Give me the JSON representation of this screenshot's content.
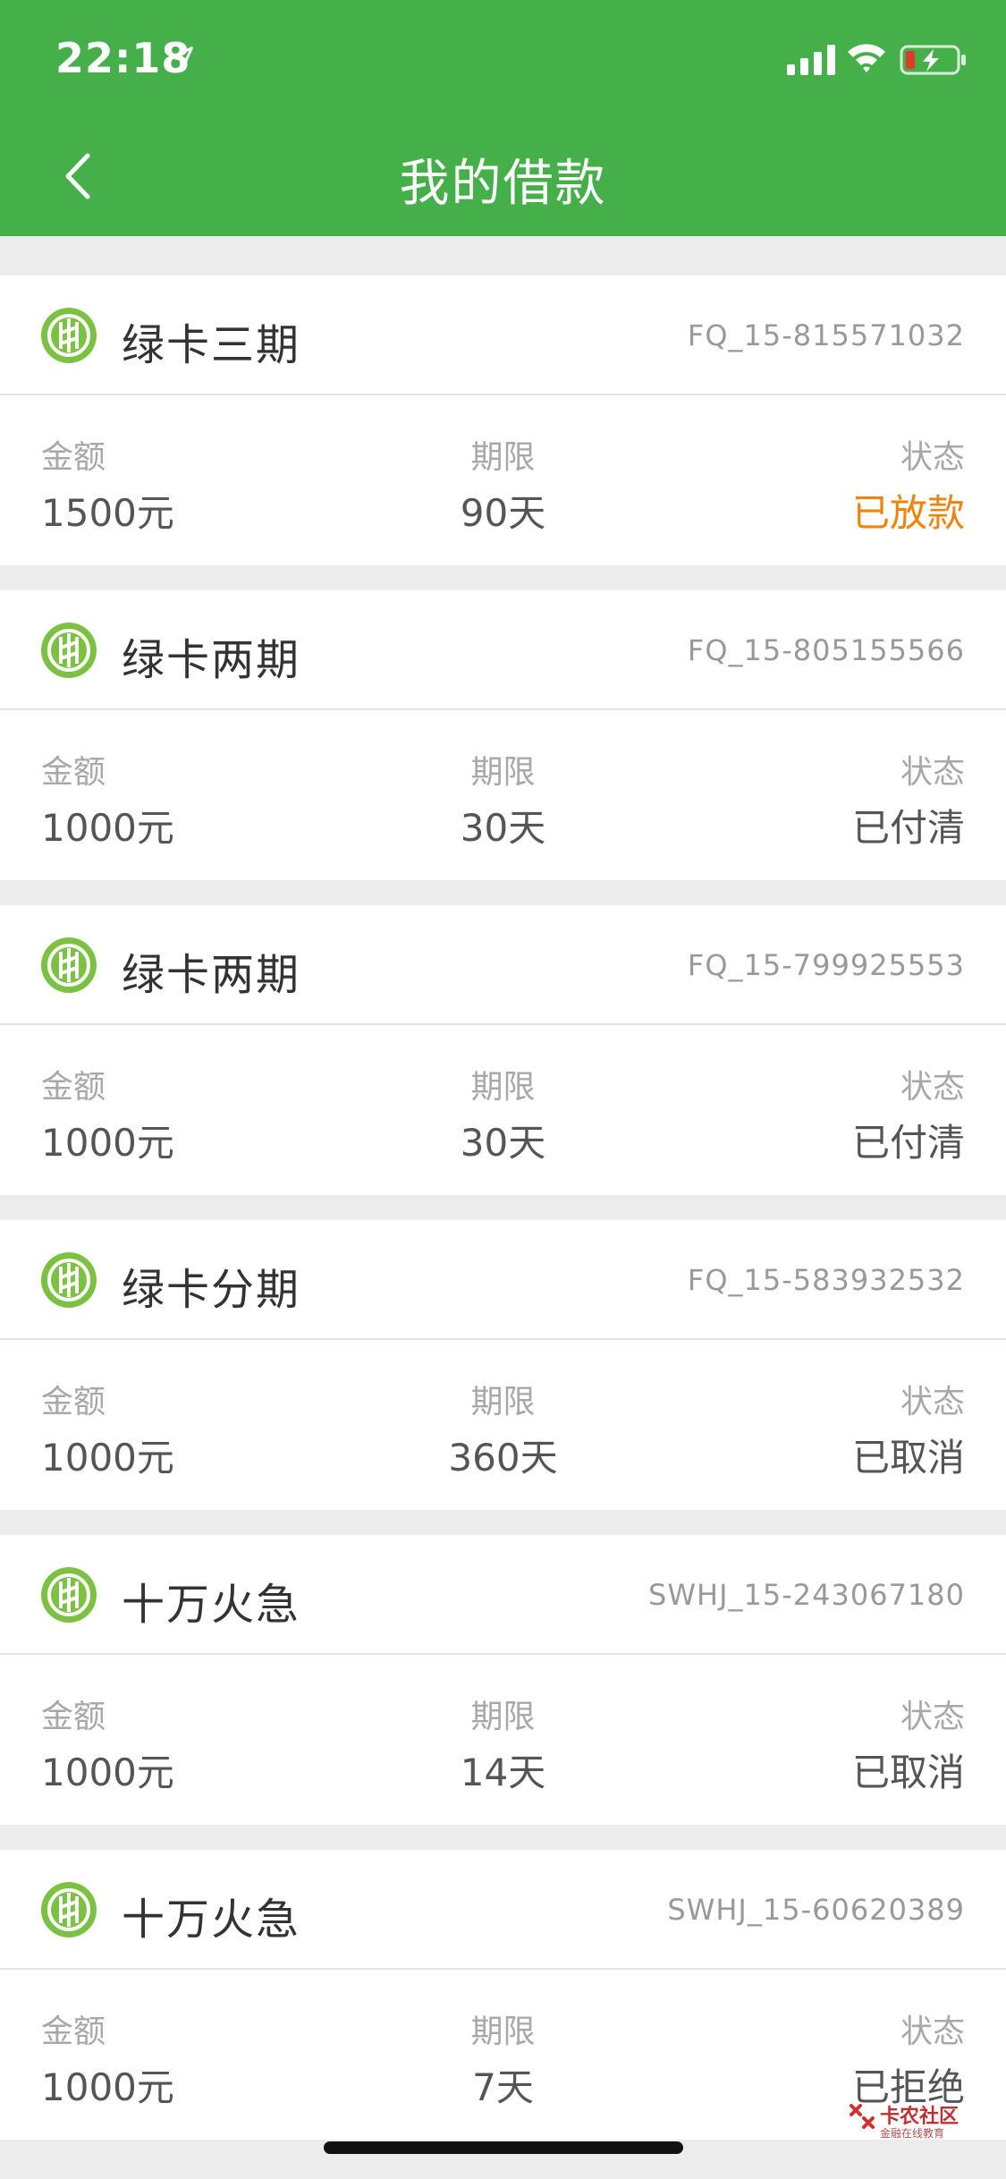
{
  "status_bar": {
    "time": "22:18"
  },
  "nav": {
    "title": "我的借款"
  },
  "labels": {
    "amount": "金额",
    "term": "期限",
    "status": "状态"
  },
  "colors": {
    "brand_green": "#45b04a",
    "status_orange": "#f0830c"
  },
  "loans": [
    {
      "product": "绿卡三期",
      "order_no": "FQ_15-815571032",
      "amount": "1500元",
      "term": "90天",
      "status": "已放款",
      "highlight": true
    },
    {
      "product": "绿卡两期",
      "order_no": "FQ_15-805155566",
      "amount": "1000元",
      "term": "30天",
      "status": "已付清",
      "highlight": false
    },
    {
      "product": "绿卡两期",
      "order_no": "FQ_15-799925553",
      "amount": "1000元",
      "term": "30天",
      "status": "已付清",
      "highlight": false
    },
    {
      "product": "绿卡分期",
      "order_no": "FQ_15-583932532",
      "amount": "1000元",
      "term": "360天",
      "status": "已取消",
      "highlight": false
    },
    {
      "product": "十万火急",
      "order_no": "SWHJ_15-243067180",
      "amount": "1000元",
      "term": "14天",
      "status": "已取消",
      "highlight": false
    },
    {
      "product": "十万火急",
      "order_no": "SWHJ_15-60620389",
      "amount": "1000元",
      "term": "7天",
      "status": "已拒绝",
      "highlight": false
    }
  ],
  "watermark": {
    "title": "卡农社区",
    "subtitle": "金融在线教育",
    "corner": "卡农社区"
  }
}
